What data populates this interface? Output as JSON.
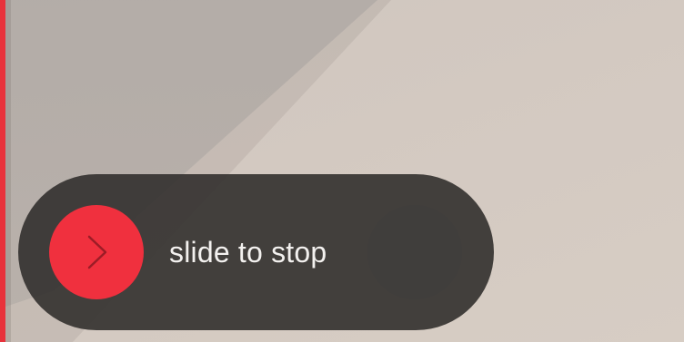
{
  "slider": {
    "label": "slide to stop",
    "thumb_color": "#f0303e",
    "track_color": "#32302e",
    "thumb_icon": "chevron-right-icon"
  },
  "screen_edge": {
    "indicator_color": "#e8323b"
  }
}
